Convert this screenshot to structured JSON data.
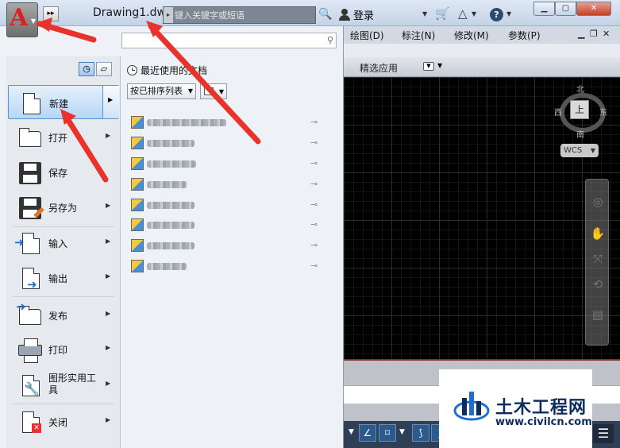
{
  "titlebar": {
    "doc_title": "Drawing1.dwg",
    "search_placeholder": "键入关键字或短语",
    "login_label": "登录",
    "quick_access_glyph": "▸▸"
  },
  "ribbon": {
    "menus": [
      "绘图(D)",
      "标注(N)",
      "修改(M)",
      "参数(P)"
    ],
    "active_tab": "精选应用"
  },
  "viewcube": {
    "north": "北",
    "south": "南",
    "east": "东",
    "west": "西",
    "top": "上",
    "wcs_label": "WCS"
  },
  "app_menu": {
    "items": [
      {
        "label": "新建",
        "icon": "new-file-icon",
        "has_submenu": true
      },
      {
        "label": "打开",
        "icon": "open-folder-icon",
        "has_submenu": true
      },
      {
        "label": "保存",
        "icon": "save-icon",
        "has_submenu": false
      },
      {
        "label": "另存为",
        "icon": "save-as-icon",
        "has_submenu": true
      },
      {
        "label": "输入",
        "icon": "import-icon",
        "has_submenu": true
      },
      {
        "label": "输出",
        "icon": "export-icon",
        "has_submenu": true
      },
      {
        "label": "发布",
        "icon": "publish-icon",
        "has_submenu": true
      },
      {
        "label": "打印",
        "icon": "print-icon",
        "has_submenu": true
      },
      {
        "label": "图形实用工具",
        "icon": "drawing-utilities-icon",
        "has_submenu": true
      },
      {
        "label": "关闭",
        "icon": "close-file-icon",
        "has_submenu": true
      }
    ]
  },
  "recent": {
    "search_value": "",
    "header": "最近使用的文档",
    "sort_label": "按已排序列表",
    "documents": [
      {
        "name": "blurred-file-1"
      },
      {
        "name": "blurred-file-2"
      },
      {
        "name": "blurred-file-3"
      },
      {
        "name": "blurred-file-4"
      },
      {
        "name": "blurred-file-5"
      },
      {
        "name": "blurred-file-6"
      },
      {
        "name": "blurred-file-7"
      },
      {
        "name": "blurred-file-8"
      }
    ]
  },
  "watermark": {
    "title": "土木工程网",
    "url": "www.civilcn.com"
  },
  "colors": {
    "accent": "#3f7fc1",
    "annotation": "#e8322b",
    "canvas": "#000000",
    "brand": "#0c2d5c"
  }
}
